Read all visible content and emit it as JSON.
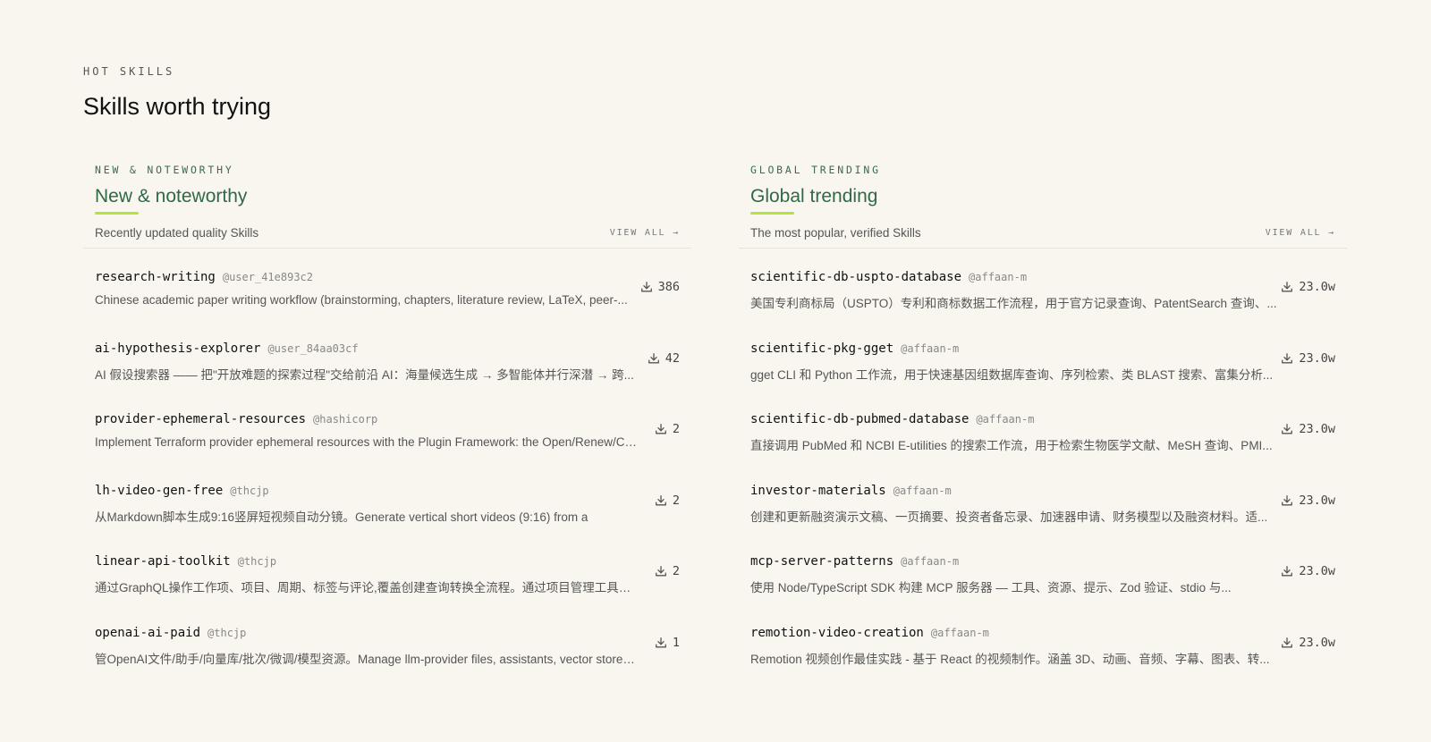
{
  "section": {
    "eyebrow": "HOT SKILLS",
    "title": "Skills worth trying"
  },
  "columns": [
    {
      "eyebrow": "NEW & NOTEWORTHY",
      "title": "New & noteworthy",
      "subtitle": "Recently updated quality Skills",
      "view_all": "VIEW ALL →",
      "items": [
        {
          "name": "research-writing",
          "author": "@user_41e893c2",
          "description": "Chinese academic paper writing workflow (brainstorming, chapters, literature review, LaTeX, peer-...",
          "downloads": "386"
        },
        {
          "name": "ai-hypothesis-explorer",
          "author": "@user_84aa03cf",
          "description": "AI 假设搜索器 —— 把\"开放难题的探索过程\"交给前沿 AI：海量候选生成 → 多智能体并行深潜 → 跨...",
          "downloads": "42"
        },
        {
          "name": "provider-ephemeral-resources",
          "author": "@hashicorp",
          "description": "Implement Terraform provider ephemeral resources with the Plugin Framework: the Open/Renew/Clo...",
          "downloads": "2"
        },
        {
          "name": "lh-video-gen-free",
          "author": "@thcjp",
          "description": "从Markdown脚本生成9:16竖屏短视频自动分镜。Generate vertical short videos (9:16) from a",
          "downloads": "2"
        },
        {
          "name": "linear-api-toolkit",
          "author": "@thcjp",
          "description": "通过GraphQL操作工作项、项目、周期、标签与评论,覆盖创建查询转换全流程。通过项目管理工具的...",
          "downloads": "2"
        },
        {
          "name": "openai-ai-paid",
          "author": "@thcjp",
          "description": "管OpenAI文件/助手/向量库/批次/微调/模型资源。Manage llm-provider files, assistants, vector stores,...",
          "downloads": "1"
        }
      ]
    },
    {
      "eyebrow": "GLOBAL TRENDING",
      "title": "Global trending",
      "subtitle": "The most popular, verified Skills",
      "view_all": "VIEW ALL →",
      "items": [
        {
          "name": "scientific-db-uspto-database",
          "author": "@affaan-m",
          "description": "美国专利商标局（USPTO）专利和商标数据工作流程，用于官方记录查询、PatentSearch 查询、...",
          "downloads": "23.0w"
        },
        {
          "name": "scientific-pkg-gget",
          "author": "@affaan-m",
          "description": "gget CLI 和 Python 工作流，用于快速基因组数据库查询、序列检索、类 BLAST 搜索、富集分析...",
          "downloads": "23.0w"
        },
        {
          "name": "scientific-db-pubmed-database",
          "author": "@affaan-m",
          "description": "直接调用 PubMed 和 NCBI E-utilities 的搜索工作流，用于检索生物医学文献、MeSH 查询、PMI...",
          "downloads": "23.0w"
        },
        {
          "name": "investor-materials",
          "author": "@affaan-m",
          "description": "创建和更新融资演示文稿、一页摘要、投资者备忘录、加速器申请、财务模型以及融资材料。适...",
          "downloads": "23.0w"
        },
        {
          "name": "mcp-server-patterns",
          "author": "@affaan-m",
          "description": "使用 Node/TypeScript SDK 构建 MCP 服务器 — 工具、资源、提示、Zod 验证、stdio 与...",
          "downloads": "23.0w"
        },
        {
          "name": "remotion-video-creation",
          "author": "@affaan-m",
          "description": "Remotion 视频创作最佳实践 - 基于 React 的视频制作。涵盖 3D、动画、音频、字幕、图表、转...",
          "downloads": "23.0w"
        }
      ]
    }
  ]
}
